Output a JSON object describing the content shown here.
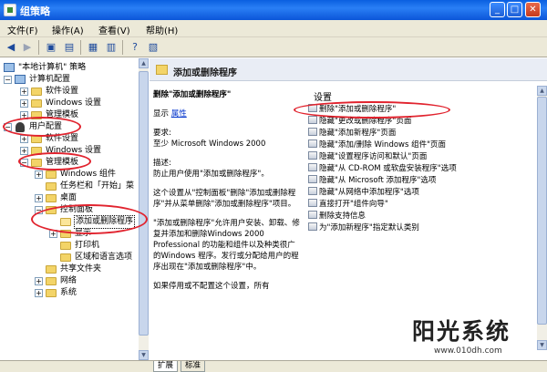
{
  "window": {
    "title": "组策略",
    "min": "_",
    "max": "□",
    "close": "✕"
  },
  "menubar": [
    "文件(F)",
    "操作(A)",
    "查看(V)",
    "帮助(H)"
  ],
  "toolbar": [
    "back-icon",
    "forward-icon",
    "up-folder-icon",
    "show-hide-tree-icon",
    "properties-icon",
    "export-icon",
    "help-icon",
    "extended-view-icon"
  ],
  "tree": [
    {
      "label": "\"本地计算机\" 策略",
      "icon": "policy-icon"
    },
    {
      "label": "计算机配置",
      "icon": "computer-icon"
    },
    {
      "label": "软件设置",
      "icon": "folder-icon"
    },
    {
      "label": "Windows 设置",
      "icon": "folder-icon"
    },
    {
      "label": "管理模板",
      "icon": "folder-icon"
    },
    {
      "label": "用户配置",
      "icon": "user-icon"
    },
    {
      "label": "软件设置",
      "icon": "folder-icon"
    },
    {
      "label": "Windows 设置",
      "icon": "folder-icon"
    },
    {
      "label": "管理模板",
      "icon": "folder-icon"
    },
    {
      "label": "Windows 组件",
      "icon": "folder-icon"
    },
    {
      "label": "任务栏和「开始」菜",
      "icon": "folder-icon"
    },
    {
      "label": "桌面",
      "icon": "folder-icon"
    },
    {
      "label": "控制面板",
      "icon": "folder-icon"
    },
    {
      "label": "添加或删除程序",
      "icon": "folder-open-icon"
    },
    {
      "label": "显示",
      "icon": "folder-icon"
    },
    {
      "label": "打印机",
      "icon": "folder-icon"
    },
    {
      "label": "区域和语言选项",
      "icon": "folder-icon"
    },
    {
      "label": "共享文件夹",
      "icon": "folder-icon"
    },
    {
      "label": "网络",
      "icon": "folder-icon"
    },
    {
      "label": "系统",
      "icon": "folder-icon"
    }
  ],
  "right": {
    "header_title": "添加或删除程序",
    "desc_title": "删除\"添加或删除程序\"",
    "display_label": "显示",
    "display_link": "属性",
    "req_label": "要求:",
    "req_text": "至少 Microsoft Windows 2000",
    "describe_label": "描述:",
    "describe_text": "防止用户使用\"添加或删除程序\"。",
    "para1": "这个设置从\"控制面板\"删除\"添加或删除程序\"并从菜单删除\"添加或删除程序\"项目。",
    "para2": "\"添加或删除程序\"允许用户安装、卸载、修复并添加和删除Windows 2000 Professional 的功能和组件以及种类很广的Windows 程序。发行或分配给用户的程序出现在\"添加或删除程序\"中。",
    "para3": "如果停用或不配置这个设置，所有",
    "settings_header": "设置",
    "settings": [
      "删除\"添加或删除程序\"",
      "隐藏\"更改或删除程序\"页面",
      "隐藏\"添加新程序\"页面",
      "隐藏\"添加/删除 Windows 组件\"页面",
      "隐藏\"设置程序访问和默认\"页面",
      "隐藏\"从 CD-ROM 或软盘安装程序\"选项",
      "隐藏\"从 Microsoft 添加程序\"选项",
      "隐藏\"从网络中添加程序\"选项",
      "直接打开\"组件向导\"",
      "删除支持信息",
      "为\"添加新程序\"指定默认类别"
    ]
  },
  "tabs": [
    "扩展",
    "标准"
  ],
  "watermark": {
    "brand": "阳光系统",
    "url": "www.010dh.com"
  }
}
